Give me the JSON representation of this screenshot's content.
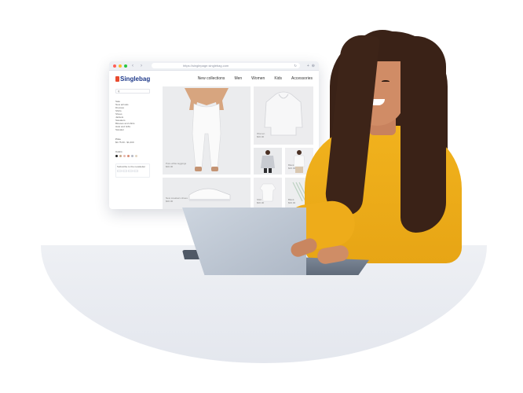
{
  "browser": {
    "url": "https://singlepage.singlebag.com",
    "nav_back": "‹",
    "nav_forward": "›",
    "reload": "↻",
    "new_tab": "+",
    "menu": "⊕"
  },
  "site": {
    "logo_text": "Singlebag",
    "brand_color": "#e84b2f",
    "logo_text_color": "#1f3a8a",
    "nav": [
      "New collections",
      "Men",
      "Women",
      "Kids",
      "Accessories"
    ],
    "search_placeholder": "Q",
    "categories": [
      "Sale",
      "New arrivals",
      "Dresses",
      "Shirts",
      "Shoes",
      "Jackets",
      "Sweaters",
      "Blouses and shirts",
      "Hats and Gifts",
      "Sweater"
    ],
    "price_label": "Price",
    "price_value": "$0.75.00 - $1,000",
    "colors_label": "Colors",
    "swatches": [
      "#222222",
      "#c9a98a",
      "#e7b9b0",
      "#d98a72",
      "#b5b9c4",
      "#e2d4c0"
    ],
    "newsletter_label": "Subscribe to the newsletter"
  },
  "products": [
    {
      "name": "Pure white leggings",
      "price": "$00.00"
    },
    {
      "name": "Women",
      "price": "$00.00"
    },
    {
      "name": "Blank",
      "price": "$00.00"
    },
    {
      "name": "Blank",
      "price": "$00.00"
    },
    {
      "name": "New sneakers shoes",
      "price": "$00.00"
    },
    {
      "name": "Shirt",
      "price": "$00.00"
    },
    {
      "name": "Blank",
      "price": "$00.00"
    }
  ]
}
